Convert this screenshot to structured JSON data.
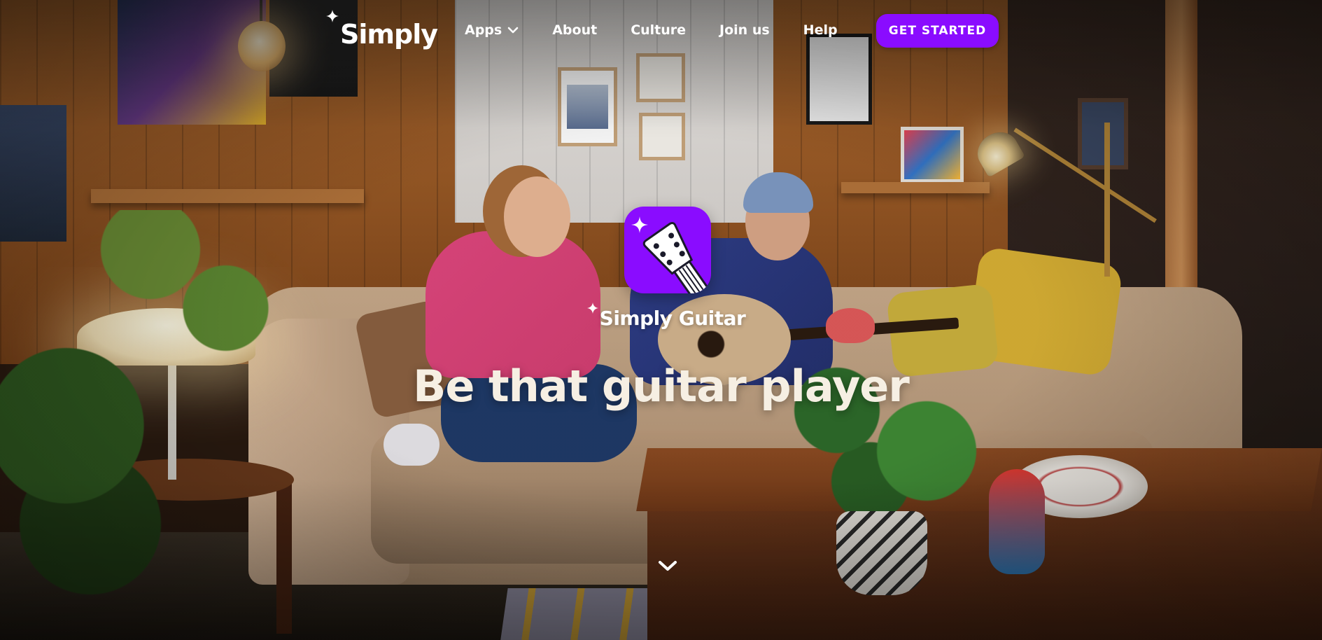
{
  "header": {
    "logo_text": "Simply",
    "nav": [
      {
        "label": "Apps",
        "has_dropdown": true
      },
      {
        "label": "About"
      },
      {
        "label": "Culture"
      },
      {
        "label": "Join us"
      },
      {
        "label": "Help"
      }
    ],
    "cta_label": "GET STARTED"
  },
  "hero": {
    "product_name": "Simply Guitar",
    "headline": "Be that guitar player"
  },
  "colors": {
    "brand_purple": "#8a0cff",
    "headline_text": "#f6efe3",
    "nav_text": "#ffffff"
  },
  "icons": [
    "sparkle-icon",
    "chevron-down-icon",
    "guitar-app-icon",
    "scroll-down-chevron-icon"
  ]
}
